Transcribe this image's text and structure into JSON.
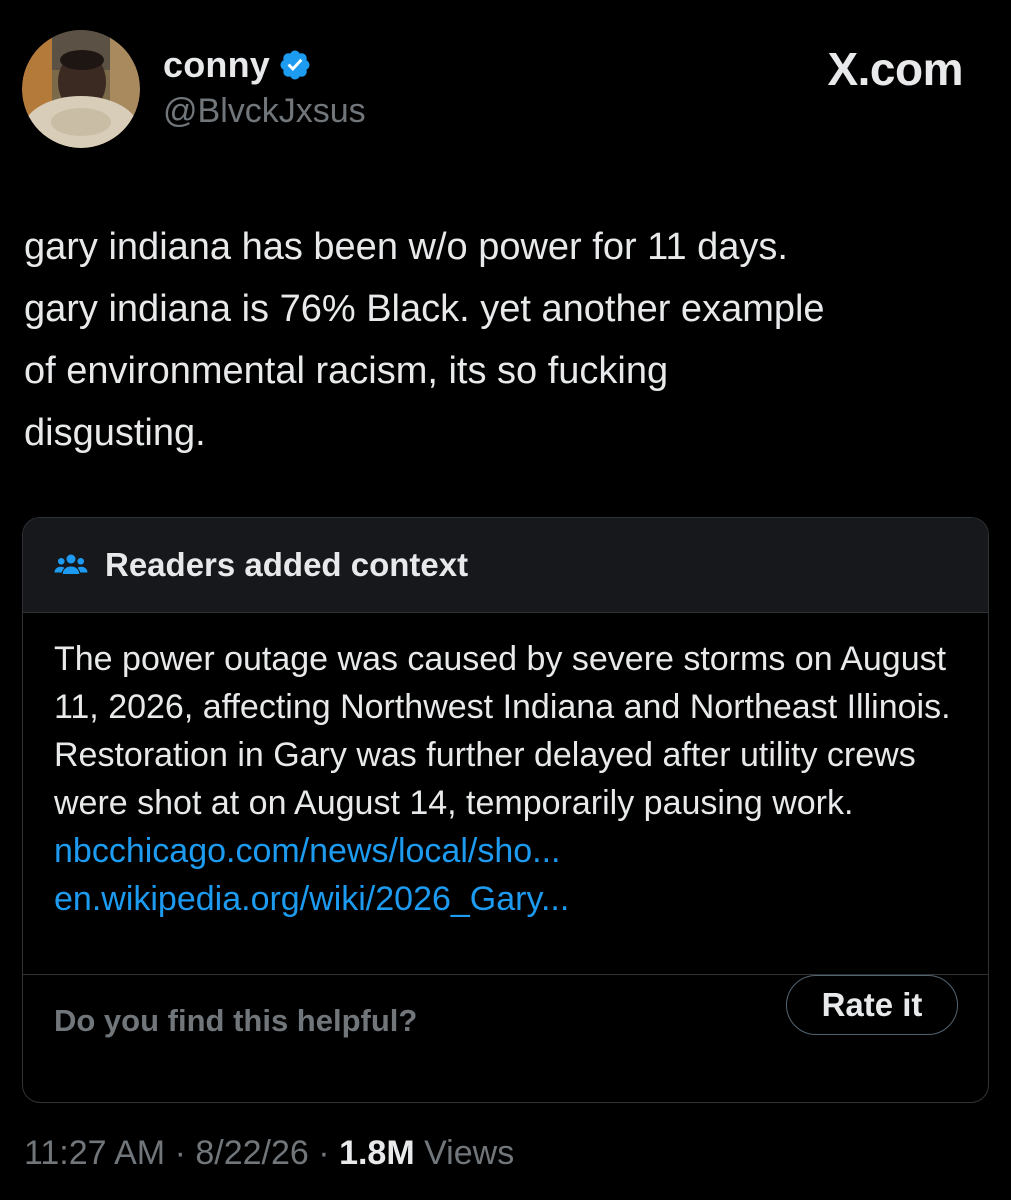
{
  "author": {
    "name": "conny",
    "handle": "@BlvckJxsus",
    "verified": true
  },
  "brand": "X.com",
  "post": {
    "text": "gary indiana has been w/o power for 11 days.\ngary indiana is 76% Black. yet another example\nof environmental racism, its so fucking\ndisgusting."
  },
  "community_note": {
    "header": "Readers added context",
    "icon": "people-group-icon",
    "body": "The power outage was caused by severe storms on August 11, 2026, affecting Northwest Indiana and Northeast Illinois. Restoration in Gary was further delayed after utility crews were shot at on August 14, temporarily pausing work.",
    "links": [
      "nbcchicago.com/news/local/sho...",
      "en.wikipedia.org/wiki/2026_Gary..."
    ],
    "helpful_prompt": "Do you find this helpful?",
    "rate_label": "Rate it"
  },
  "meta": {
    "time": "11:27 AM",
    "separator": "·",
    "date": "8/22/26",
    "views_count": "1.8M",
    "views_label": "Views"
  },
  "colors": {
    "background": "#000000",
    "text": "#e7e9ea",
    "muted": "#71767b",
    "link": "#1d9bf0",
    "verified": "#1d9bf0",
    "border": "#2f3336"
  }
}
